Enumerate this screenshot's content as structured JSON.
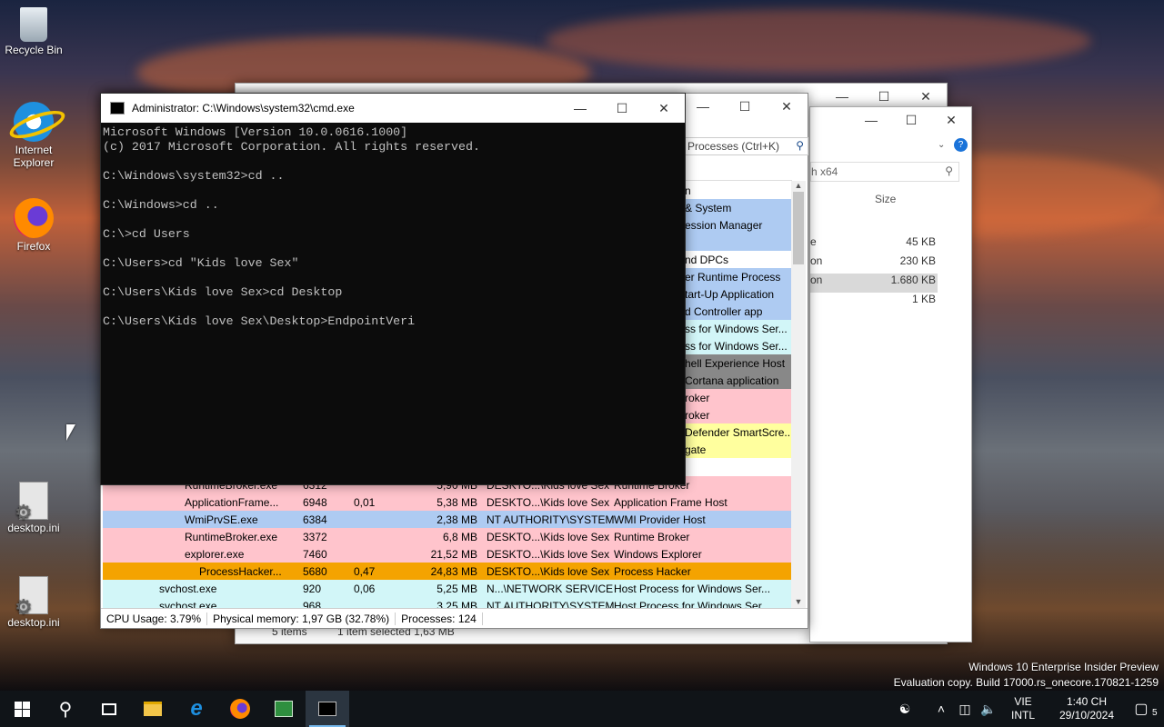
{
  "desktop": {
    "icons": [
      {
        "label": "Recycle Bin"
      },
      {
        "label": "Internet Explorer"
      },
      {
        "label": "Firefox"
      },
      {
        "label": "desktop.ini"
      },
      {
        "label": "desktop.ini"
      }
    ],
    "watermark": {
      "line1": "Windows 10 Enterprise Insider Preview",
      "line2": "Evaluation copy. Build 17000.rs_onecore.170821-1259"
    }
  },
  "explorer_back": {
    "search_placeholder": "h x64",
    "column_size": "Size",
    "rows": [
      {
        "name": "e",
        "size": "45 KB"
      },
      {
        "name": "on",
        "size": "230 KB"
      },
      {
        "name": "on",
        "size": "1.680 KB"
      },
      {
        "name": "",
        "size": "1 KB"
      }
    ],
    "status_items": "5 items",
    "status_selected": "1 item selected  1,63 MB"
  },
  "process_hacker": {
    "search_placeholder": "Processes (Ctrl+K)",
    "partial_rows": [
      {
        "desc": "n",
        "color": "#ffffff"
      },
      {
        "desc": "& System",
        "color": "#aecbf2"
      },
      {
        "desc": "ession Manager",
        "color": "#aecbf2"
      },
      {
        "desc": "",
        "color": "#aecbf2"
      },
      {
        "desc": "nd DPCs",
        "color": "#ffffff"
      },
      {
        "desc": "er Runtime Process",
        "color": "#aecbf2"
      },
      {
        "desc": "tart-Up Application",
        "color": "#aecbf2"
      },
      {
        "desc": "d Controller app",
        "color": "#aecbf2"
      },
      {
        "desc": "ss for Windows Ser...",
        "color": "#d2f6f8"
      },
      {
        "desc": "ss for Windows Ser...",
        "color": "#d2f6f8"
      },
      {
        "desc": "hell Experience Host",
        "color": "#888888"
      },
      {
        "desc": "Cortana application",
        "color": "#888888"
      },
      {
        "desc": "roker",
        "color": "#ffc4cc"
      },
      {
        "desc": "roker",
        "color": "#ffc4cc"
      },
      {
        "desc": "Defender SmartScre...",
        "color": "#ffff9e"
      },
      {
        "desc": "gate",
        "color": "#ffff9e"
      }
    ],
    "rows": [
      {
        "name": "RuntimeBroker.exe",
        "pid": "6312",
        "cpu": "",
        "mem": "5,90 MB",
        "user": "DESKTO...\\Kids love Sex",
        "desc": "Runtime Broker",
        "color": "#ffc4cc"
      },
      {
        "name": "ApplicationFrame...",
        "pid": "6948",
        "cpu": "0,01",
        "mem": "5,38 MB",
        "user": "DESKTO...\\Kids love Sex",
        "desc": "Application Frame Host",
        "color": "#ffc4cc"
      },
      {
        "name": "WmiPrvSE.exe",
        "pid": "6384",
        "cpu": "",
        "mem": "2,38 MB",
        "user": "NT AUTHORITY\\SYSTEM",
        "desc": "WMI Provider Host",
        "color": "#aecbf2"
      },
      {
        "name": "RuntimeBroker.exe",
        "pid": "3372",
        "cpu": "",
        "mem": "6,8 MB",
        "user": "DESKTO...\\Kids love Sex",
        "desc": "Runtime Broker",
        "color": "#ffc4cc"
      },
      {
        "name": "explorer.exe",
        "pid": "7460",
        "cpu": "",
        "mem": "21,52 MB",
        "user": "DESKTO...\\Kids love Sex",
        "desc": "Windows Explorer",
        "color": "#ffc4cc"
      },
      {
        "name": "ProcessHacker...",
        "pid": "5680",
        "cpu": "0,47",
        "mem": "24,83 MB",
        "user": "DESKTO...\\Kids love Sex",
        "desc": "Process Hacker",
        "color": "#f4a300"
      },
      {
        "name": "svchost.exe",
        "pid": "920",
        "cpu": "0,06",
        "mem": "5,25 MB",
        "user": "N...\\NETWORK SERVICE",
        "desc": "Host Process for Windows Ser...",
        "color": "#d2f6f8"
      },
      {
        "name": "svchost.exe",
        "pid": "968",
        "cpu": "",
        "mem": "3,25 MB",
        "user": "NT AUTHORITY\\SYSTEM",
        "desc": "Host Process for Windows Ser...",
        "color": "#d2f6f8"
      }
    ],
    "status": {
      "cpu": "CPU Usage: 3.79%",
      "memory": "Physical memory: 1,97 GB (32.78%)",
      "processes": "Processes: 124"
    }
  },
  "cmd": {
    "title": "Administrator: C:\\Windows\\system32\\cmd.exe",
    "text": "Microsoft Windows [Version 10.0.0616.1000]\n(c) 2017 Microsoft Corporation. All rights reserved.\n\nC:\\Windows\\system32>cd ..\n\nC:\\Windows>cd ..\n\nC:\\>cd Users\n\nC:\\Users>cd \"Kids love Sex\"\n\nC:\\Users\\Kids love Sex>cd Desktop\n\nC:\\Users\\Kids love Sex\\Desktop>EndpointVeri"
  },
  "taskbar": {
    "lang_top": "VIE",
    "lang_bottom": "INTL",
    "time": "1:40 CH",
    "date": "29/10/2024",
    "notification_count": "5"
  }
}
